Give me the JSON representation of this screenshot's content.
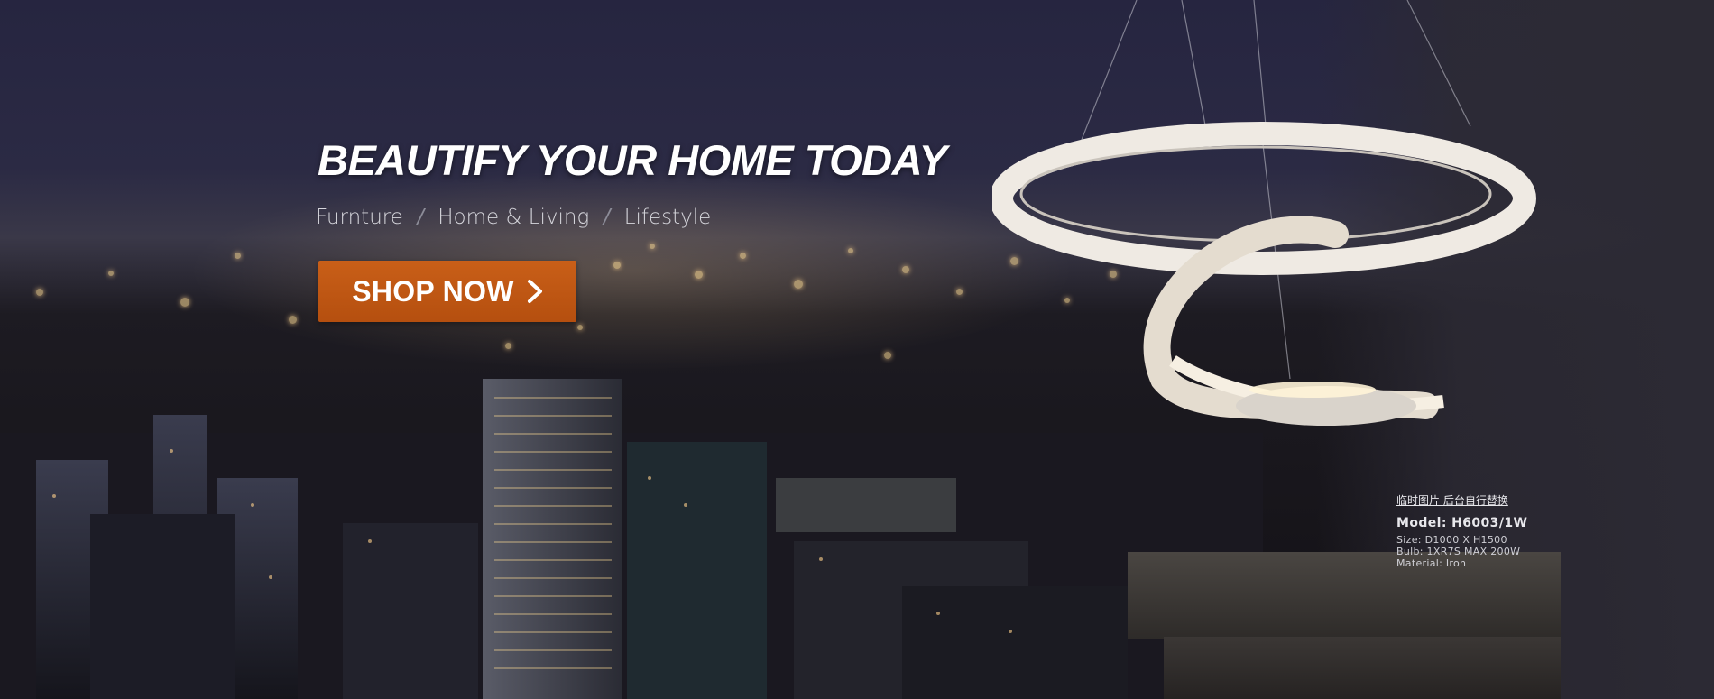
{
  "hero": {
    "headline": "BEAUTIFY YOUR HOME TODAY",
    "categories": [
      "Furnture",
      "Home & Living",
      "Lifestyle"
    ],
    "category_separator": "/",
    "cta_label": "SHOP NOW",
    "cta_icon": "chevron-right-icon"
  },
  "product_info": {
    "note": "临时图片 后台自行替换",
    "model": "Model: H6003/1W",
    "size": "Size: D1000 X H1500",
    "bulb": "Bulb: 1XR7S  MAX 200W",
    "material": "Material: Iron"
  },
  "colors": {
    "cta_background": "#c95f18",
    "headline": "#ffffff",
    "sky": "#262540"
  }
}
